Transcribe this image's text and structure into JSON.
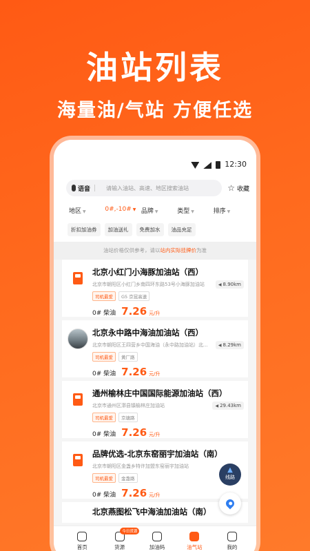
{
  "promo": {
    "title": "油站列表",
    "subtitle": "海量油/气站 方便任选"
  },
  "status_bar": {
    "time": "12:30"
  },
  "search": {
    "voice_label": "语音",
    "placeholder": "请输入油站、高速、地区搜索油站",
    "favorite_label": "收藏"
  },
  "filters": [
    {
      "label": "地区",
      "active": false
    },
    {
      "label": "0#,-10#",
      "active": true
    },
    {
      "label": "品牌",
      "active": false
    },
    {
      "label": "类型",
      "active": false
    },
    {
      "label": "排序",
      "active": false
    }
  ],
  "tags": [
    "折扣加油券",
    "加油送礼",
    "免费加水",
    "油品充足"
  ],
  "notice": {
    "prefix": "油站价格仅供参考，请以",
    "highlight": "站内实际挂牌价",
    "suffix": "为准"
  },
  "stations": [
    {
      "name": "北京小红门小海豚加油站（西）",
      "address": "北京市朝阳区小红门乡南四环东路53号小海豚加油站",
      "distance": "8.90km",
      "chip_primary": "司机最爱",
      "chip_secondary": "G5 京昆高速",
      "fuel": "0# 柴油",
      "price": "7.26",
      "unit": "元/升",
      "thumb": "pump"
    },
    {
      "name": "北京永中路中海油加油站（西）",
      "address": "北京市朝阳区王四营乡中国海油（永中路加油站）北...",
      "distance": "8.29km",
      "chip_primary": "司机最爱",
      "chip_secondary": "黄厂路",
      "fuel": "0# 柴油",
      "price": "7.26",
      "unit": "元/升",
      "thumb": "photo"
    },
    {
      "name": "通州榆林庄中国国际能源加油站（西）",
      "address": "北京市通州区漷县镇榆林庄加油站",
      "distance": "29.43km",
      "chip_primary": "司机最爱",
      "chip_secondary": "京塘路",
      "fuel": "0# 柴油",
      "price": "7.26",
      "unit": "元/升",
      "thumb": "pump"
    },
    {
      "name": "品牌优选-北京东窑丽宇加油站（南）",
      "address": "北京市朝阳区金盏乡特许加盟东窑丽宇加油站",
      "distance": "",
      "chip_primary": "司机最爱",
      "chip_secondary": "金盏路",
      "fuel": "0# 柴油",
      "price": "7.26",
      "unit": "元/升",
      "thumb": "pump"
    }
  ],
  "partial_station": {
    "name": "北京燕图松飞中海油加油站（南）"
  },
  "floating": {
    "route_label": "线路"
  },
  "tabbar": [
    {
      "label": "首页",
      "icon": "home-icon",
      "active": false
    },
    {
      "label": "货源",
      "icon": "cargo-icon",
      "active": false,
      "badge": "今日货源"
    },
    {
      "label": "加油码",
      "icon": "qr-code-icon",
      "active": false
    },
    {
      "label": "油气站",
      "icon": "gas-station-icon",
      "active": true
    },
    {
      "label": "我的",
      "icon": "user-icon",
      "active": false
    }
  ],
  "colors": {
    "accent": "#ff5a14",
    "background": "#ff6a1e"
  }
}
